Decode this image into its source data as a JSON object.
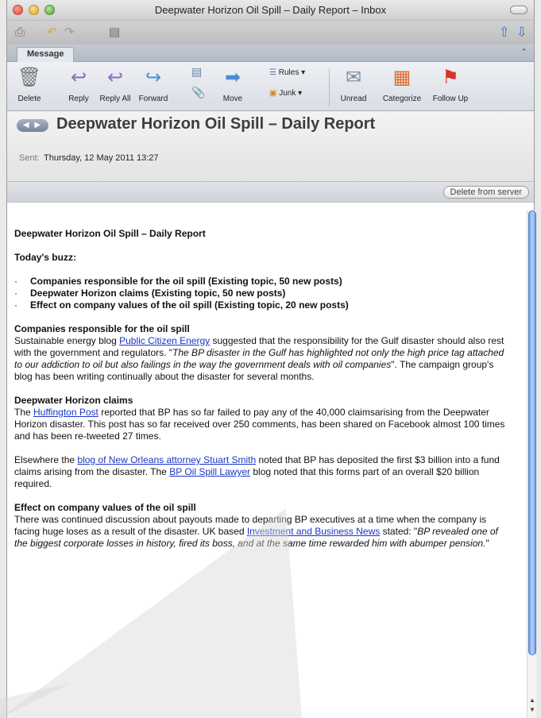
{
  "window": {
    "title": "Deepwater Horizon Oil Spill – Daily Report – Inbox"
  },
  "quickbar": {
    "icons": [
      "printer-icon",
      "undo-icon",
      "redo-icon",
      "document-icon",
      "arrow-up-icon",
      "arrow-down-icon"
    ]
  },
  "ribbon": {
    "tab": "Message",
    "buttons": {
      "delete": "Delete",
      "reply": "Reply",
      "reply_all": "Reply All",
      "forward": "Forward",
      "move": "Move",
      "rules": "Rules",
      "junk": "Junk",
      "unread": "Unread",
      "categorize": "Categorize",
      "follow_up": "Follow Up"
    }
  },
  "message": {
    "subject": "Deepwater Horizon Oil Spill – Daily Report",
    "sent_label": "Sent:",
    "sent_value": "Thursday, 12 May 2011 13:27",
    "delete_from_server": "Delete from server"
  },
  "body": {
    "heading": "Deepwater Horizon Oil Spill – Daily Report",
    "buzz_heading": "Today's buzz:",
    "buzz_items": [
      "Companies responsible for the oil spill (Existing topic, 50 new posts)",
      "Deepwater Horizon claims (Existing topic, 50 new posts)",
      "Effect on company values of the oil spill (Existing topic, 20 new posts)"
    ],
    "s1": {
      "title": "Companies responsible for the oil spill",
      "t1": "Sustainable energy blog ",
      "link1": "Public Citizen Energy",
      "t2": " suggested that the responsibility for the Gulf disaster should also rest with the government and regulators. \"",
      "quote": "The BP disaster in the Gulf has highlighted not only the high price tag attached to our addiction to oil but also failings in the way the government deals with oil companies",
      "t3": "\". The campaign group's blog has been writing continually about the disaster for several months."
    },
    "s2": {
      "title": "Deepwater Horizon claims",
      "t1": "The ",
      "link1": "Huffington Post",
      "t2": " reported that BP has so far failed to pay any of the 40,000 claimsarising from the Deepwater Horizon disaster. This post has so far received over 250 comments, has been shared on Facebook almost 100 times and has been re-tweeted 27 times."
    },
    "s3": {
      "t1": "Elsewhere the ",
      "link1": "blog of New Orleans attorney Stuart Smith",
      "t2": " noted that BP has deposited the first $3 billion into a fund claims arising from the disaster. The ",
      "link2": "BP Oil Spill Lawyer",
      "t3": " blog noted that this forms part of an overall $20 billion required."
    },
    "s4": {
      "title": "Effect on company values of the oil spill",
      "t1": "There was continued discussion about payouts made to departing BP executives at a time when the company is facing huge loses as a result of the disaster. UK based ",
      "link1": "Investment and Business News",
      "t2": " stated: \"",
      "quote": "BP revealed one of the biggest corporate losses in history, fired its boss, and at the same time rewarded him with abumper pension.",
      "t3": "\""
    }
  }
}
